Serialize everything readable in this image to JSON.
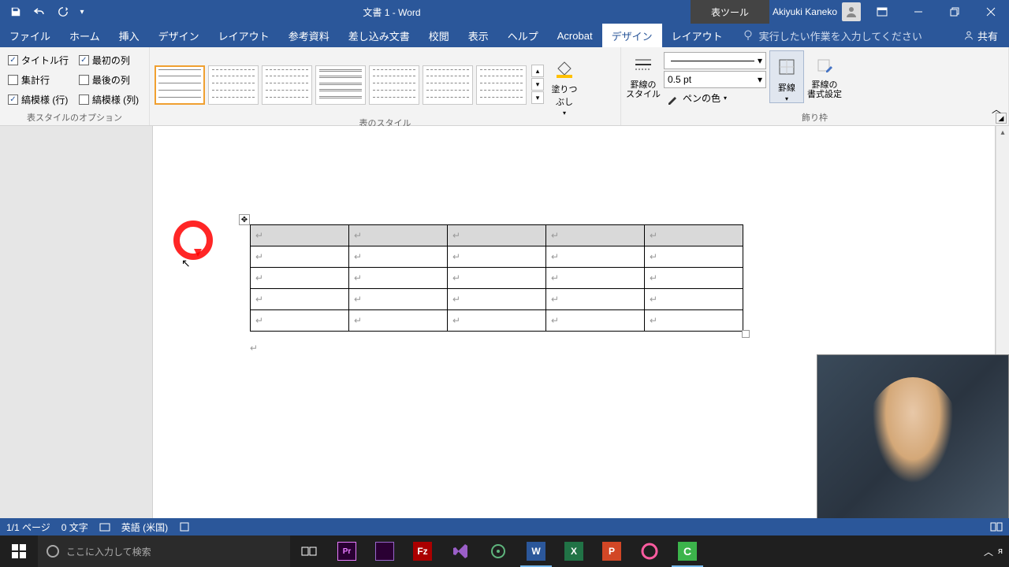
{
  "title": "文書 1  -  Word",
  "toolContext": "表ツール",
  "user": "Akiyuki Kaneko",
  "tabs": [
    "ファイル",
    "ホーム",
    "挿入",
    "デザイン",
    "レイアウト",
    "参考資料",
    "差し込み文書",
    "校閲",
    "表示",
    "ヘルプ",
    "Acrobat",
    "デザイン",
    "レイアウト"
  ],
  "activeTab": 11,
  "tellMe": "実行したい作業を入力してください",
  "share": "共有",
  "ribbon": {
    "styleOptions": {
      "label": "表スタイルのオプション",
      "items": [
        {
          "label": "タイトル行",
          "checked": true
        },
        {
          "label": "最初の列",
          "checked": true
        },
        {
          "label": "集計行",
          "checked": false
        },
        {
          "label": "最後の列",
          "checked": false
        },
        {
          "label": "縞模様 (行)",
          "checked": true
        },
        {
          "label": "縞模様 (列)",
          "checked": false
        }
      ]
    },
    "tableStyles": {
      "label": "表のスタイル"
    },
    "shading": {
      "label": "塗りつぶし"
    },
    "borders": {
      "label": "飾り枠",
      "borderStyle": "罫線の\nスタイル",
      "penSize": "0.5 pt",
      "penColor": "ペンの色",
      "bordersBtn": "罫線",
      "bordersFormat": "罫線の\n書式設定"
    }
  },
  "status": {
    "page": "1/1 ページ",
    "words": "0 文字",
    "lang": "英語 (米国)"
  },
  "taskbar": {
    "searchPlaceholder": "ここに入力して検索"
  }
}
